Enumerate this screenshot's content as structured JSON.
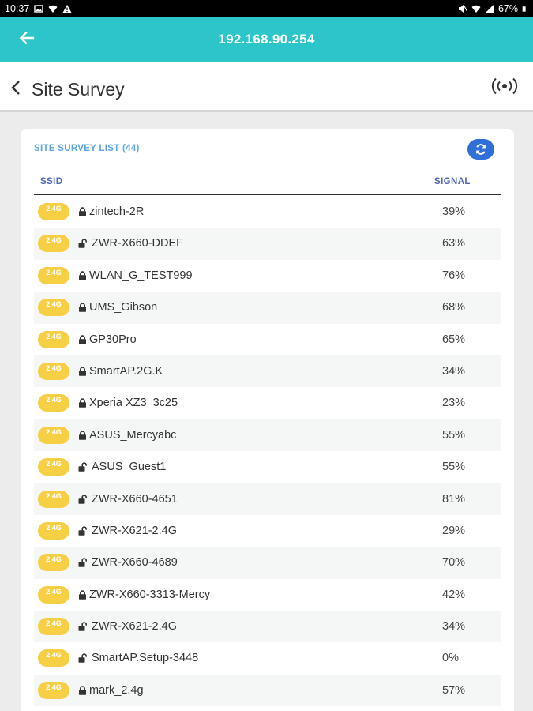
{
  "status_bar": {
    "time": "10:37",
    "battery": "67%"
  },
  "app_bar": {
    "title": "192.168.90.254"
  },
  "sub_header": {
    "title": "Site Survey"
  },
  "card": {
    "title": "SITE SURVEY LIST (44)",
    "col_ssid": "SSID",
    "col_signal": "SIGNAL"
  },
  "rows": [
    {
      "band": "2.4G",
      "ssid": "zintech-2R",
      "signal": "39%",
      "locked": true
    },
    {
      "band": "2.4G",
      "ssid": "ZWR-X660-DDEF",
      "signal": "63%",
      "locked": false
    },
    {
      "band": "2.4G",
      "ssid": "WLAN_G_TEST999",
      "signal": "76%",
      "locked": true
    },
    {
      "band": "2.4G",
      "ssid": "UMS_Gibson",
      "signal": "68%",
      "locked": true
    },
    {
      "band": "2.4G",
      "ssid": "GP30Pro",
      "signal": "65%",
      "locked": true
    },
    {
      "band": "2.4G",
      "ssid": "SmartAP.2G.K",
      "signal": "34%",
      "locked": true
    },
    {
      "band": "2.4G",
      "ssid": "Xperia XZ3_3c25",
      "signal": "23%",
      "locked": true
    },
    {
      "band": "2.4G",
      "ssid": "ASUS_Mercyabc",
      "signal": "55%",
      "locked": true
    },
    {
      "band": "2.4G",
      "ssid": "ASUS_Guest1",
      "signal": "55%",
      "locked": false
    },
    {
      "band": "2.4G",
      "ssid": "ZWR-X660-4651",
      "signal": "81%",
      "locked": false
    },
    {
      "band": "2.4G",
      "ssid": "ZWR-X621-2.4G",
      "signal": "29%",
      "locked": false
    },
    {
      "band": "2.4G",
      "ssid": "ZWR-X660-4689",
      "signal": "70%",
      "locked": false
    },
    {
      "band": "2.4G",
      "ssid": "ZWR-X660-3313-Mercy",
      "signal": "42%",
      "locked": true
    },
    {
      "band": "2.4G",
      "ssid": "ZWR-X621-2.4G",
      "signal": "34%",
      "locked": false
    },
    {
      "band": "2.4G",
      "ssid": "SmartAP.Setup-3448",
      "signal": "0%",
      "locked": false
    },
    {
      "band": "2.4G",
      "ssid": "mark_2.4g",
      "signal": "57%",
      "locked": true
    }
  ],
  "icons": {
    "back": "arrow-left-icon",
    "chevron": "chevron-left-icon",
    "survey": "wireless-broadcast-icon",
    "refresh": "refresh-icon",
    "locked": "lock-icon",
    "unlocked": "unlock-icon"
  },
  "colors": {
    "app_bar": "#2cc5c9",
    "badge": "#f7cf45",
    "refresh_button": "#2e6fd8",
    "card_title": "#5aa6e8",
    "column_header": "#4f67b8"
  }
}
